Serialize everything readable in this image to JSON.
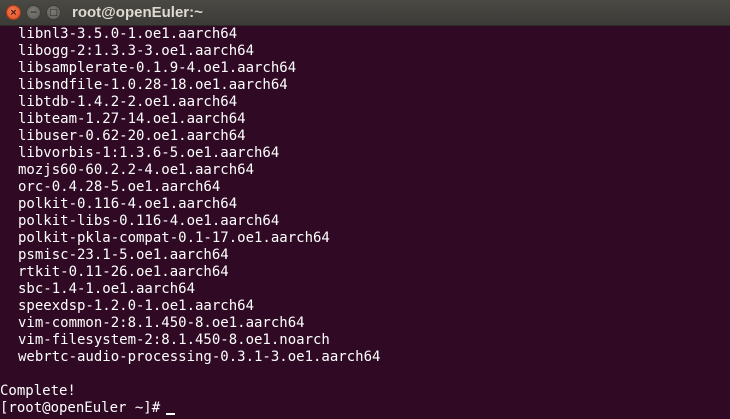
{
  "window": {
    "title": "root@openEuler:~",
    "buttons": {
      "close_glyph": "×",
      "minimize_glyph": "−",
      "maximize_glyph": "□"
    }
  },
  "terminal": {
    "package_lines": [
      "libnl3-3.5.0-1.oe1.aarch64",
      "libogg-2:1.3.3-3.oe1.aarch64",
      "libsamplerate-0.1.9-4.oe1.aarch64",
      "libsndfile-1.0.28-18.oe1.aarch64",
      "libtdb-1.4.2-2.oe1.aarch64",
      "libteam-1.27-14.oe1.aarch64",
      "libuser-0.62-20.oe1.aarch64",
      "libvorbis-1:1.3.6-5.oe1.aarch64",
      "mozjs60-60.2.2-4.oe1.aarch64",
      "orc-0.4.28-5.oe1.aarch64",
      "polkit-0.116-4.oe1.aarch64",
      "polkit-libs-0.116-4.oe1.aarch64",
      "polkit-pkla-compat-0.1-17.oe1.aarch64",
      "psmisc-23.1-5.oe1.aarch64",
      "rtkit-0.11-26.oe1.aarch64",
      "sbc-1.4-1.oe1.aarch64",
      "speexdsp-1.2.0-1.oe1.aarch64",
      "vim-common-2:8.1.450-8.oe1.aarch64",
      "vim-filesystem-2:8.1.450-8.oe1.noarch",
      "webrtc-audio-processing-0.3.1-3.oe1.aarch64"
    ],
    "complete_text": "Complete!",
    "prompt": "[root@openEuler ~]#"
  },
  "colors": {
    "background": "#300a24",
    "text": "#ffffff",
    "titlebar": "#3c3b37",
    "close_button": "#e0481b"
  }
}
